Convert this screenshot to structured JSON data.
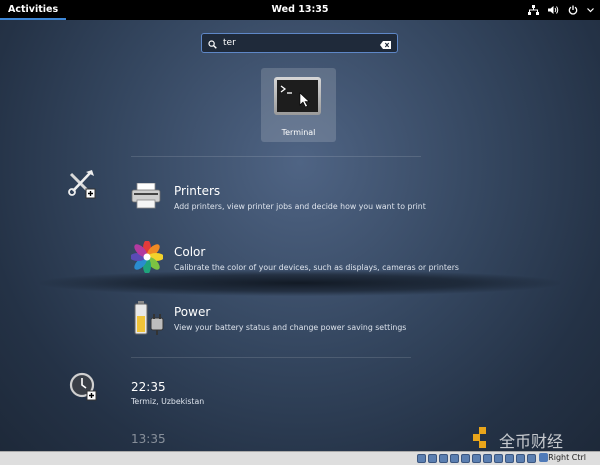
{
  "topbar": {
    "activities_label": "Activities",
    "clock": "Wed 13:35",
    "tray_icons": [
      "network-icon",
      "volume-icon",
      "power-icon",
      "chevron-down-icon"
    ]
  },
  "search": {
    "value": "ter",
    "icons": [
      "search-icon",
      "clear-icon"
    ]
  },
  "app_result": {
    "label": "Terminal",
    "icon": "terminal-icon"
  },
  "settings_results": [
    {
      "title": "Printers",
      "description": "Add printers, view printer jobs and decide how you want to print",
      "icon": "printer-icon"
    },
    {
      "title": "Color",
      "description": "Calibrate the color of your devices, such as displays, cameras or printers",
      "icon": "color-icon"
    },
    {
      "title": "Power",
      "description": "View your battery status and change power saving settings",
      "icon": "power-battery-icon"
    }
  ],
  "provider_icons": [
    "settings-tools-icon",
    "clocks-icon"
  ],
  "clock_results": [
    {
      "time": "22:35",
      "location": "Termiz, Uzbekistan"
    },
    {
      "time": "13:35"
    }
  ],
  "vm_statusbar": {
    "host_key": "Right Ctrl"
  },
  "watermark": {
    "text": "全币财经"
  },
  "colors": {
    "accent": "#3d86d6",
    "topbar_bg": "#000000",
    "search_border": "#5e87c7"
  }
}
